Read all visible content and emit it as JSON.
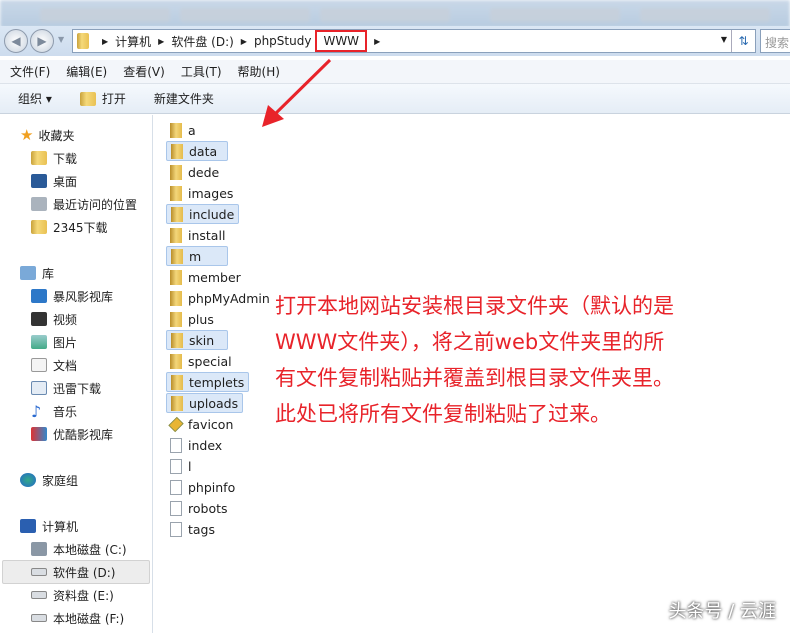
{
  "address": {
    "crumbs": [
      "计算机",
      "软件盘 (D:)",
      "phpStudy",
      "WWW"
    ],
    "search_placeholder": "搜索"
  },
  "menu": [
    "文件(F)",
    "编辑(E)",
    "查看(V)",
    "工具(T)",
    "帮助(H)"
  ],
  "toolbar": {
    "organize": "组织 ▾",
    "open": "打开",
    "new_folder": "新建文件夹"
  },
  "sidebar": {
    "favorites": {
      "label": "收藏夹",
      "items": [
        "下载",
        "桌面",
        "最近访问的位置",
        "2345下载"
      ]
    },
    "libraries": {
      "label": "库",
      "items": [
        "暴风影视库",
        "视频",
        "图片",
        "文档",
        "迅雷下载",
        "音乐",
        "优酷影视库"
      ]
    },
    "homegroup": "家庭组",
    "computer": {
      "label": "计算机",
      "items": [
        "本地磁盘 (C:)",
        "软件盘 (D:)",
        "资料盘 (E:)",
        "本地磁盘 (F:)"
      ]
    }
  },
  "files": [
    {
      "name": "a",
      "type": "dir",
      "sel": false
    },
    {
      "name": "data",
      "type": "dir",
      "sel": true
    },
    {
      "name": "dede",
      "type": "dir",
      "sel": false
    },
    {
      "name": "images",
      "type": "dir",
      "sel": false
    },
    {
      "name": "include",
      "type": "dir",
      "sel": true
    },
    {
      "name": "install",
      "type": "dir",
      "sel": false
    },
    {
      "name": "m",
      "type": "dir",
      "sel": true
    },
    {
      "name": "member",
      "type": "dir",
      "sel": false
    },
    {
      "name": "phpMyAdmin",
      "type": "dir",
      "sel": false
    },
    {
      "name": "plus",
      "type": "dir",
      "sel": false
    },
    {
      "name": "skin",
      "type": "dir",
      "sel": true
    },
    {
      "name": "special",
      "type": "dir",
      "sel": false
    },
    {
      "name": "templets",
      "type": "dir",
      "sel": true
    },
    {
      "name": "uploads",
      "type": "dir",
      "sel": true
    },
    {
      "name": "favicon",
      "type": "fav",
      "sel": false
    },
    {
      "name": "index",
      "type": "doc",
      "sel": false
    },
    {
      "name": "l",
      "type": "doc",
      "sel": false
    },
    {
      "name": "phpinfo",
      "type": "doc",
      "sel": false
    },
    {
      "name": "robots",
      "type": "doc",
      "sel": false
    },
    {
      "name": "tags",
      "type": "doc",
      "sel": false
    }
  ],
  "annotation": [
    "打开本地网站安装根目录文件夹（默认的是",
    "WWW文件夹），将之前web文件夹里的所",
    "有文件复制粘贴并覆盖到根目录文件夹里。",
    "此处已将所有文件复制粘贴了过来。"
  ],
  "watermark": "头条号 / 云涯",
  "colors": {
    "annotation": "#e8232a",
    "selection": "#dbe8f8"
  }
}
